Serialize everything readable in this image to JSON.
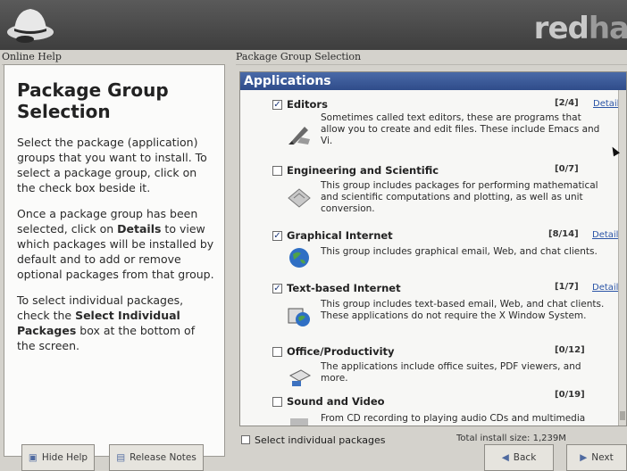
{
  "header": {
    "brand_red": "red",
    "brand_hat": "ha"
  },
  "panes": {
    "left_label": "Online Help",
    "right_label": "Package Group Selection"
  },
  "help": {
    "title": "Package Group Selection",
    "para1": "Select the package (application) groups that you want to install. To select a package group, click on the check box beside it.",
    "para2_a": "Once a package group has been selected, click on ",
    "para2_b": "Details",
    "para2_c": " to view which packages will be installed by default and to add or remove optional packages from that group.",
    "para3_a": "To select individual packages, check the ",
    "para3_b": "Select Individual Packages",
    "para3_c": " box at the bottom of the screen."
  },
  "category": "Applications",
  "groups": [
    {
      "name": "Editors",
      "checked": true,
      "count": "[2/4]",
      "details": "Details",
      "icon": "editor-pen-icon",
      "desc": "Sometimes called text editors, these are programs that allow you to create and edit files. These include Emacs and Vi."
    },
    {
      "name": "Engineering and Scientific",
      "checked": false,
      "count": "[0/7]",
      "details": "",
      "icon": "ruler-icon",
      "desc": "This group includes packages for performing mathematical and scientific computations and plotting, as well as unit conversion."
    },
    {
      "name": "Graphical Internet",
      "checked": true,
      "count": "[8/14]",
      "details": "Details",
      "icon": "globe-icon",
      "desc": "This group includes graphical email, Web, and chat clients."
    },
    {
      "name": "Text-based Internet",
      "checked": true,
      "count": "[1/7]",
      "details": "Details",
      "icon": "terminal-globe-icon",
      "desc": "This group includes text-based email, Web, and chat clients. These applications do not require the X Window System."
    },
    {
      "name": "Office/Productivity",
      "checked": false,
      "count": "[0/12]",
      "details": "",
      "icon": "office-icon",
      "desc": "The applications include office suites, PDF viewers, and more."
    },
    {
      "name": "Sound and Video",
      "checked": false,
      "count": "[0/19]",
      "details": "",
      "icon": "sound-video-icon",
      "desc": "From CD recording to playing audio CDs and multimedia"
    }
  ],
  "footer": {
    "select_individual": "Select individual packages",
    "total_size": "Total install size: 1,239M",
    "hide_help": "Hide Help",
    "release_notes": "Release Notes",
    "back": "Back",
    "next": "Next"
  }
}
